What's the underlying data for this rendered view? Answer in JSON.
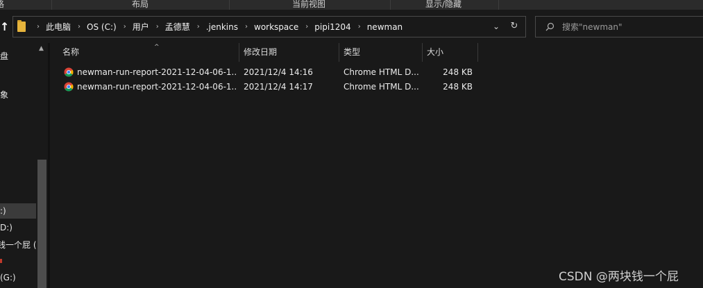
{
  "ribbon": {
    "groups": [
      "格",
      "布局",
      "当前视图",
      "显示/隐藏"
    ]
  },
  "address": {
    "breadcrumbs": [
      "此电脑",
      "OS (C:)",
      "用户",
      "孟德慧",
      ".jenkins",
      "workspace",
      "pipi1204",
      "newman"
    ],
    "separator": "›",
    "dropdown_glyph": "⌄",
    "refresh_glyph": "↻"
  },
  "search": {
    "placeholder": "搜索\"newman\""
  },
  "nav_pane": {
    "items": [
      "盘",
      "象",
      ":)",
      "D:)",
      "钱一个屁 (E",
      "",
      "(G:)"
    ],
    "selected_index": 2
  },
  "columns": {
    "name": "名称",
    "modified": "修改日期",
    "type": "类型",
    "size": "大小"
  },
  "files": [
    {
      "name": "newman-run-report-2021-12-04-06-1...",
      "modified": "2021/12/4 14:16",
      "type": "Chrome HTML D...",
      "size": "248 KB",
      "icon": "chrome-icon"
    },
    {
      "name": "newman-run-report-2021-12-04-06-1...",
      "modified": "2021/12/4 14:17",
      "type": "Chrome HTML D...",
      "size": "248 KB",
      "icon": "chrome-icon"
    }
  ],
  "watermark": "CSDN @两块钱一个屁",
  "colors": {
    "background": "#191919",
    "folder": "#e6b43c",
    "selected_nav": "#3b3b3b"
  }
}
